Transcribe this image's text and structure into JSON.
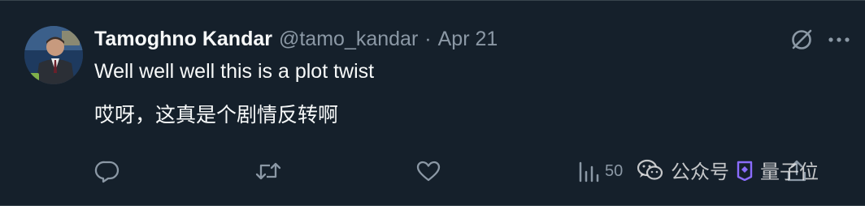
{
  "tweet": {
    "author_name": "Tamoghno Kandar",
    "handle": "@tamo_kandar",
    "separator": "·",
    "date": "Apr 21",
    "text_en": "Well well well this is a plot twist",
    "text_zh": "哎呀，这真是个剧情反转啊"
  },
  "actions": {
    "reply_icon": "reply-icon",
    "retweet_icon": "retweet-icon",
    "like_icon": "like-icon",
    "views_icon": "views-icon",
    "views_count": "50",
    "share_icon": "share-icon"
  },
  "header_icons": {
    "grok": "grok-icon",
    "more": "more-icon"
  },
  "watermark": {
    "text1": "公众号",
    "text2": "量子位"
  },
  "colors": {
    "background": "#15202b",
    "primary_text": "#f7f9f9",
    "secondary_text": "#8b98a5",
    "divider": "#38444d"
  }
}
